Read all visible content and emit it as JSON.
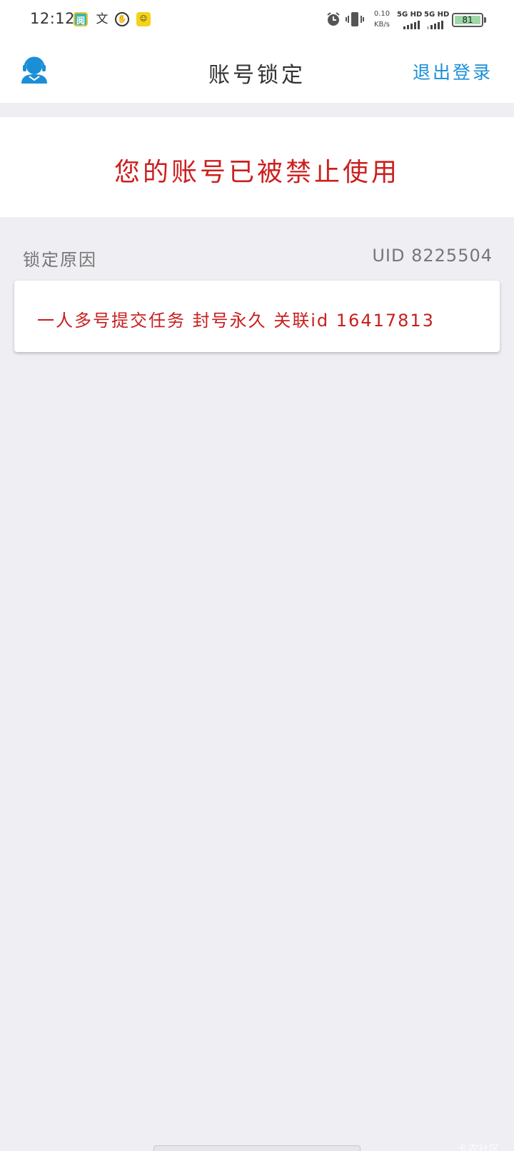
{
  "status_bar": {
    "time": "12:12",
    "app_icons": [
      "reader-app-icon",
      "text-app-icon",
      "hand-app-icon",
      "yellow-app-icon"
    ],
    "speed_value": "0.10",
    "speed_unit": "KB/s",
    "network_1": "5G HD",
    "network_2": "5G HD",
    "battery_level": "81"
  },
  "header": {
    "title": "账号锁定",
    "logout_label": "退出登录"
  },
  "banner": {
    "message": "您的账号已被禁止使用"
  },
  "reason": {
    "label": "锁定原因",
    "uid_label": "UID",
    "uid_value": "8225504",
    "text": "一人多号提交任务 封号永久 关联id 16417813"
  },
  "watermark": "卡农社区",
  "colors": {
    "accent": "#1a8fd6",
    "alert_red": "#cc1f1f",
    "background": "#eeeef3"
  }
}
